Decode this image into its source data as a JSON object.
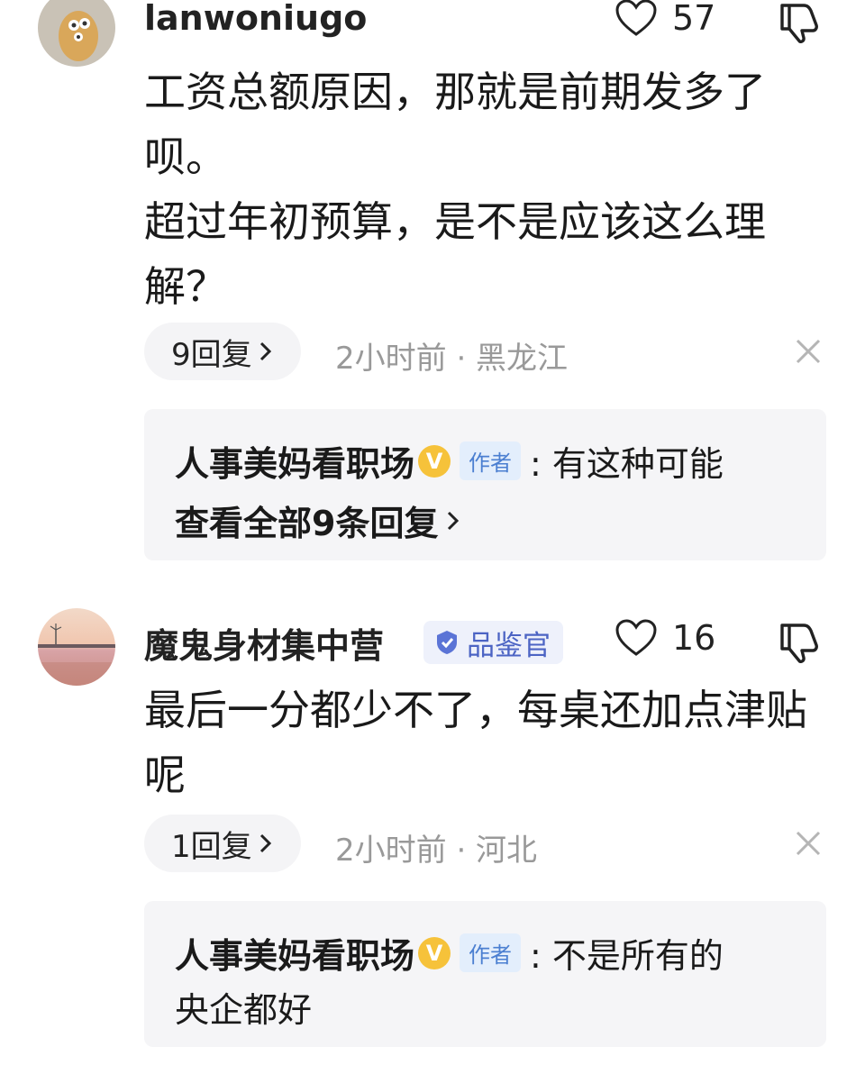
{
  "comments": [
    {
      "username": "lanwoniugo",
      "likes": "57",
      "content_lines": [
        "工资总额原因，那就是前期发多了呗。",
        "超过年初预算，是不是应该这么理解？"
      ],
      "replies_label": "9回复",
      "meta": "2小时前 · 黑龙江",
      "reply_preview": {
        "author": "人事美妈看职场",
        "v_badge": "V",
        "author_tag": "作者",
        "text": ": 有这种可能",
        "view_all": "查看全部9条回复"
      }
    },
    {
      "username": "魔鬼身材集中营",
      "badge": "品鉴官",
      "likes": "16",
      "content_lines": [
        "最后一分都少不了，每桌还加点津贴呢"
      ],
      "replies_label": "1回复",
      "meta": "2小时前 · 河北",
      "reply_preview": {
        "author": "人事美妈看职场",
        "v_badge": "V",
        "author_tag": "作者",
        "text": ": 不是所有的",
        "text_line2": "央企都好"
      }
    }
  ],
  "colors": {
    "accent_blue": "#4b7fd1",
    "v_badge": "#f6c23a",
    "meta_gray": "#999999"
  }
}
